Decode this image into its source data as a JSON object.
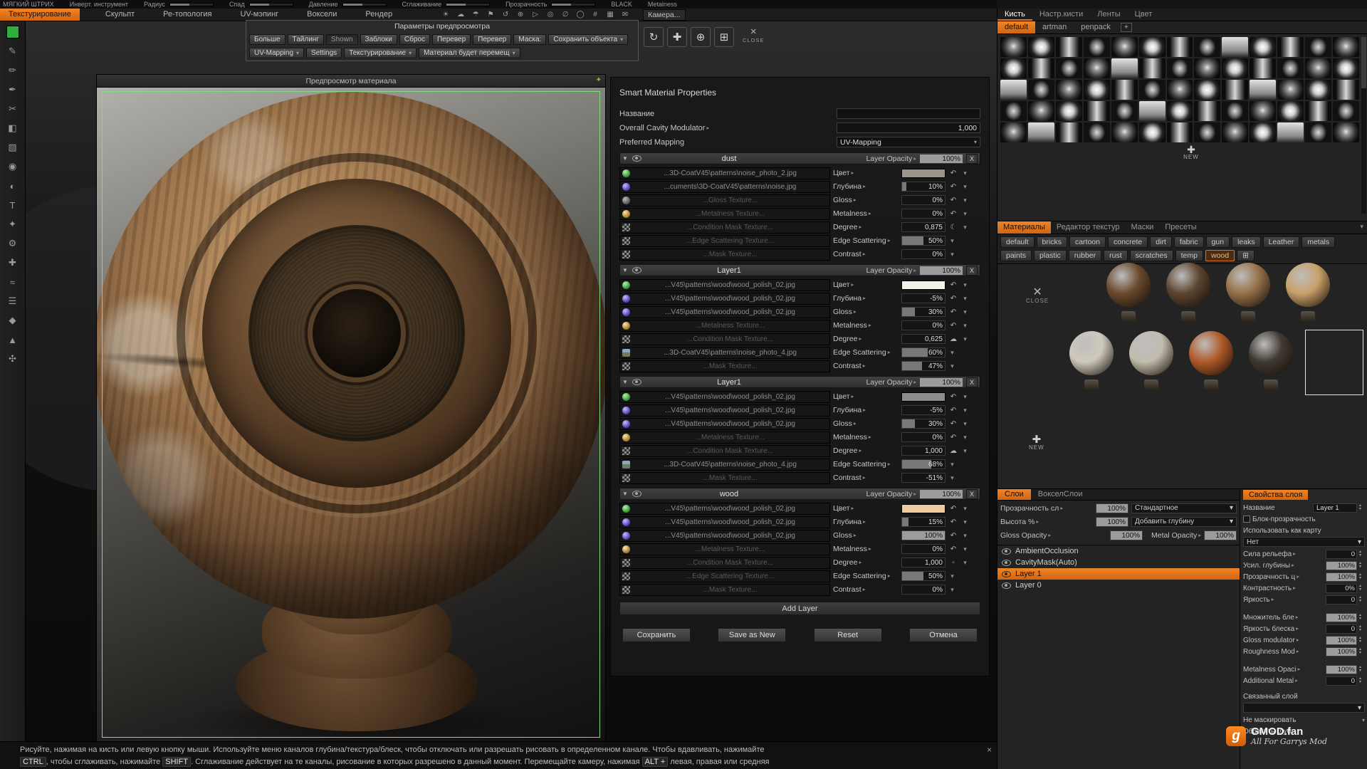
{
  "accent": "#e0711c",
  "topbar": {
    "row1_items": [
      "МЯГКИЙ ШТРИХ",
      "Инверт. инструмент",
      "Радиус",
      "Спад",
      "Давление",
      "Сглаживание",
      "Прозрачность",
      "BLACK",
      "Metalness"
    ],
    "menu_tabs": [
      {
        "label": "Текстурирование",
        "active": true
      },
      {
        "label": "Скульпт"
      },
      {
        "label": "Ре-топология"
      },
      {
        "label": "UV-мэпинг"
      },
      {
        "label": "Воксели"
      },
      {
        "label": "Рендер"
      }
    ],
    "icons": [
      {
        "name": "sun-icon",
        "glyph": "☀"
      },
      {
        "name": "cloud-icon",
        "glyph": "☁"
      },
      {
        "name": "umbrella-icon",
        "glyph": "☂"
      },
      {
        "name": "flag-icon",
        "glyph": "⚑"
      },
      {
        "name": "undo-icon",
        "glyph": "↺"
      },
      {
        "name": "target-icon",
        "glyph": "⊕"
      },
      {
        "name": "play-icon",
        "glyph": "▷"
      },
      {
        "name": "circle-icon",
        "glyph": "◎"
      },
      {
        "name": "null-icon",
        "glyph": "∅"
      },
      {
        "name": "ring-icon",
        "glyph": "◯"
      },
      {
        "name": "grid-icon",
        "glyph": "#"
      },
      {
        "name": "table-icon",
        "glyph": "▦"
      },
      {
        "name": "mail-icon",
        "glyph": "✉"
      }
    ],
    "camera_label": "Камера..."
  },
  "left_tools": [
    {
      "name": "brush-tool",
      "glyph": "✎"
    },
    {
      "name": "pencil-tool",
      "glyph": "✏"
    },
    {
      "name": "pen-tool",
      "glyph": "✒"
    },
    {
      "name": "cut-tool",
      "glyph": "✂"
    },
    {
      "name": "shape-tool",
      "glyph": "◧"
    },
    {
      "name": "hatch-tool",
      "glyph": "▨"
    },
    {
      "name": "dot-tool",
      "glyph": "◉"
    },
    {
      "name": "shade-tool",
      "glyph": "◐"
    },
    {
      "name": "text-tool",
      "glyph": "T"
    },
    {
      "name": "star-tool",
      "glyph": "✦"
    },
    {
      "name": "settings-tool",
      "glyph": "⚙"
    },
    {
      "name": "add-tool",
      "glyph": "✚"
    },
    {
      "name": "wave-tool",
      "glyph": "≈"
    },
    {
      "name": "list-tool",
      "glyph": "☰"
    },
    {
      "name": "diamond-tool",
      "glyph": "◆"
    },
    {
      "name": "prim-tool",
      "glyph": "▲"
    },
    {
      "name": "flower-tool",
      "glyph": "✣"
    }
  ],
  "viewport": {
    "preview_title": "Предпросмотр материала"
  },
  "preview_params": {
    "title": "Параметры предпросмотра",
    "buttons": [
      {
        "label": "Больше"
      },
      {
        "label": "Тайлинг"
      },
      {
        "label": "Shown",
        "pressed": true
      },
      {
        "label": "Заблоки"
      },
      {
        "label": "Сброс"
      },
      {
        "label": "Перевер"
      },
      {
        "label": "Перевер"
      },
      {
        "label": "Маска:"
      },
      {
        "label": "Сохранить объекта",
        "dropdown": true
      }
    ],
    "row2": [
      {
        "label": "UV-Mapping",
        "dropdown": true
      },
      {
        "label": "Settings"
      },
      {
        "label": "Текстурирование",
        "dropdown": true
      },
      {
        "label": "Материал будет перемещ",
        "dropdown": true
      }
    ],
    "transform_icons": [
      {
        "name": "rotate-icon",
        "glyph": "↻"
      },
      {
        "name": "move-icon",
        "glyph": "✚"
      },
      {
        "name": "zoom-icon",
        "glyph": "⊕"
      },
      {
        "name": "pan-icon",
        "glyph": "⊞"
      }
    ],
    "close_label": "CLOSE"
  },
  "smart_material": {
    "title": "Smart Material Properties",
    "name_label": "Название",
    "cavity_label": "Overall Cavity Modulator",
    "cavity_value": "1,000",
    "mapping_label": "Preferred Mapping",
    "mapping_value": "UV-Mapping",
    "opacity_label": "Layer Opacity",
    "add_layer_label": "Add Layer",
    "buttons": [
      "Сохранить",
      "Save as New",
      "Reset",
      "Отмена"
    ],
    "layers": [
      {
        "name": "dust",
        "opacity": "100%",
        "rows": [
          {
            "icon": "sph-green",
            "texture": "...3D-CoatV45\\patterns\\noise_photo_2.jpg",
            "prop": "Цвет",
            "swatch": "#9b948a",
            "undo": true
          },
          {
            "icon": "sph-purple",
            "texture": "...cuments\\3D-CoatV45\\patterns\\noise.jpg",
            "prop": "Глубина",
            "value": "10%",
            "undo": true
          },
          {
            "icon": "sph-dim",
            "texture": "...Gloss Texture...",
            "dim": true,
            "prop": "Gloss",
            "value": "0%",
            "undo": true
          },
          {
            "icon": "sph-gold",
            "texture": "...Metalness Texture...",
            "dim": true,
            "prop": "Metalness",
            "value": "0%",
            "undo": true
          },
          {
            "icon": "checker",
            "texture": "...Condition Mask Texture...",
            "dim": true,
            "prop": "Degree",
            "value": "0,875",
            "extra": "moon"
          },
          {
            "icon": "checker",
            "texture": "...Edge Scattering Texture...",
            "dim": true,
            "prop": "Edge Scattering",
            "value": "50%"
          },
          {
            "icon": "checker",
            "texture": "...Mask Texture...",
            "dim": true,
            "prop": "Contrast",
            "value": "0%"
          }
        ]
      },
      {
        "name": "Layer1",
        "opacity": "100%",
        "rows": [
          {
            "icon": "sph-green",
            "texture": "...V45\\patterns\\wood\\wood_polish_02.jpg",
            "prop": "Цвет",
            "swatch": "#f4f1ea",
            "undo": true
          },
          {
            "icon": "sph-purple",
            "texture": "...V45\\patterns\\wood\\wood_polish_02.jpg",
            "prop": "Глубина",
            "value": "-5%",
            "undo": true
          },
          {
            "icon": "sph-purple",
            "texture": "...V45\\patterns\\wood\\wood_polish_02.jpg",
            "prop": "Gloss",
            "value": "30%",
            "undo": true
          },
          {
            "icon": "sph-gold",
            "texture": "...Metalness Texture...",
            "dim": true,
            "prop": "Metalness",
            "value": "0%",
            "undo": true
          },
          {
            "icon": "checker",
            "texture": "...Condition Mask Texture...",
            "dim": true,
            "prop": "Degree",
            "value": "0,625",
            "extra": "cloud"
          },
          {
            "icon": "photo",
            "texture": "...3D-CoatV45\\patterns\\noise_photo_4.jpg",
            "prop": "Edge Scattering",
            "value": "60%"
          },
          {
            "icon": "checker",
            "texture": "...Mask Texture...",
            "dim": true,
            "prop": "Contrast",
            "value": "47%"
          }
        ]
      },
      {
        "name": "Layer1",
        "opacity": "100%",
        "rows": [
          {
            "icon": "sph-green",
            "texture": "...V45\\patterns\\wood\\wood_polish_02.jpg",
            "prop": "Цвет",
            "swatch": "#8e8d8a",
            "undo": true
          },
          {
            "icon": "sph-purple",
            "texture": "...V45\\patterns\\wood\\wood_polish_02.jpg",
            "prop": "Глубина",
            "value": "-5%",
            "undo": true
          },
          {
            "icon": "sph-purple",
            "texture": "...V45\\patterns\\wood\\wood_polish_02.jpg",
            "prop": "Gloss",
            "value": "30%",
            "undo": true
          },
          {
            "icon": "sph-gold",
            "texture": "...Metalness Texture...",
            "dim": true,
            "prop": "Metalness",
            "value": "0%",
            "undo": true
          },
          {
            "icon": "checker",
            "texture": "...Condition Mask Texture...",
            "dim": true,
            "prop": "Degree",
            "value": "1,000",
            "extra": "cloud"
          },
          {
            "icon": "photo",
            "texture": "...3D-CoatV45\\patterns\\noise_photo_4.jpg",
            "prop": "Edge Scattering",
            "value": "68%"
          },
          {
            "icon": "checker",
            "texture": "...Mask Texture...",
            "dim": true,
            "prop": "Contrast",
            "value": "-51%"
          }
        ]
      },
      {
        "name": "wood",
        "opacity": "100%",
        "rows": [
          {
            "icon": "sph-green",
            "texture": "...V45\\patterns\\wood\\wood_polish_02.jpg",
            "prop": "Цвет",
            "swatch": "#eecb9f",
            "undo": true
          },
          {
            "icon": "sph-purple",
            "texture": "...V45\\patterns\\wood\\wood_polish_02.jpg",
            "prop": "Глубина",
            "value": "15%",
            "undo": true
          },
          {
            "icon": "sph-purple",
            "texture": "...V45\\patterns\\wood\\wood_polish_02.jpg",
            "prop": "Gloss",
            "value": "100%",
            "undo": true
          },
          {
            "icon": "sph-gold",
            "texture": "...Metalness Texture...",
            "dim": true,
            "prop": "Metalness",
            "value": "0%",
            "undo": true
          },
          {
            "icon": "checker",
            "texture": "...Condition Mask Texture...",
            "dim": true,
            "prop": "Degree",
            "value": "1,000",
            "extra": "square"
          },
          {
            "icon": "checker",
            "texture": "...Edge Scattering Texture...",
            "dim": true,
            "prop": "Edge Scattering",
            "value": "50%"
          },
          {
            "icon": "checker",
            "texture": "...Mask Texture...",
            "dim": true,
            "prop": "Contrast",
            "value": "0%"
          }
        ]
      }
    ]
  },
  "brush_panel": {
    "tabs": [
      {
        "label": "Кисть",
        "active": true
      },
      {
        "label": "Настр.кисти"
      },
      {
        "label": "Ленты"
      },
      {
        "label": "Цвет"
      }
    ],
    "preset_tabs": [
      {
        "label": "default",
        "active": true
      },
      {
        "label": "artman"
      },
      {
        "label": "penpack"
      }
    ],
    "grid": {
      "rows": 5,
      "cols": 13
    },
    "new_label": "NEW"
  },
  "materials_panel": {
    "tabs": [
      {
        "label": "Материалы",
        "active": true
      },
      {
        "label": "Редактор текстур"
      },
      {
        "label": "Маски"
      },
      {
        "label": "Пресеты"
      }
    ],
    "categories": [
      "default",
      "bricks",
      "cartoon",
      "concrete",
      "dirt",
      "fabric",
      "gun",
      "leaks",
      "Leather",
      "metals",
      "paints",
      "plastic",
      "rubber",
      "rust",
      "scratches",
      "temp",
      "wood"
    ],
    "active_category": "wood",
    "close_label": "CLOSE",
    "new_label": "NEW",
    "thumbs": [
      {
        "color": "#6b4a2e"
      },
      {
        "color": "#5d4530"
      },
      {
        "color": "#96714a"
      },
      {
        "color": "#c9a06a"
      },
      {
        "color": "#cfc9bd"
      },
      {
        "color": "#c2bcae"
      },
      {
        "color": "#b05a28"
      },
      {
        "color": "#403a32"
      }
    ]
  },
  "layers_panel": {
    "tabs": [
      {
        "label": "Слои",
        "active": true
      },
      {
        "label": "ВокселСлои"
      }
    ],
    "controls": {
      "row1_label": "Прозрачность сл",
      "row1_value": "100%",
      "row1_dropdown": "Стандартное",
      "row2_label": "Высота %",
      "row2_value": "100%",
      "row2_dropdown": "Добавить глубину",
      "row3a_label": "Gloss Opacity",
      "row3a_value": "100%",
      "row3b_label": "Metal Opacity",
      "row3b_value": "100%"
    },
    "items": [
      {
        "name": "AmbientOcclusion"
      },
      {
        "name": "CavityMask(Auto)"
      },
      {
        "name": "Layer 1",
        "selected": true
      },
      {
        "name": "Layer 0"
      }
    ]
  },
  "layer_props": {
    "tab": "Свойства слоя",
    "name_label": "Название",
    "name_value": "Layer 1",
    "lock_label": "Блок-прозрачность",
    "use_as_label": "Использовать как карту",
    "use_as_value": "Нет",
    "rows": [
      {
        "label": "Сила рельефа",
        "value": "0"
      },
      {
        "label": "Усил. глубины",
        "value": "100%"
      },
      {
        "label": "Прозрачность ц",
        "value": "100%"
      },
      {
        "label": "Контрастность",
        "value": "0%"
      },
      {
        "label": "Яркость",
        "value": "0",
        "gap": true
      },
      {
        "label": "Множитель бле",
        "value": "100%"
      },
      {
        "label": "Яркость блеска",
        "value": "0"
      },
      {
        "label": "Gloss modulator",
        "value": "100%"
      },
      {
        "label": "Roughness Mod",
        "value": "100%",
        "gap": true
      },
      {
        "label": "Metalness Opaci",
        "value": "100%"
      },
      {
        "label": "Additional Metal",
        "value": "0"
      }
    ],
    "linked_label": "Связанный слой",
    "mask_label": "Не маскировать",
    "invert_label": "Обратить глуб"
  },
  "statusbar": {
    "line1": "Рисуйте, нажимая на кисть или левую кнопку мыши. Используйте меню каналов глубина/текстура/блеск, чтобы отключать или разрешать рисовать в определенном канале. Чтобы вдавливать, нажимайте",
    "line2_segments": [
      {
        "text": "CTRL",
        "key": true
      },
      {
        "text": ", чтобы сглаживать, нажимайте "
      },
      {
        "text": "SHIFT",
        "key": true
      },
      {
        "text": ". Сглаживание действует на те каналы, рисование в которых разрешено в данный момент. Перемещайте камеру, нажимая "
      },
      {
        "text": "ALT +",
        "key": true
      },
      {
        "text": " левая, правая или средняя"
      }
    ]
  },
  "watermark": {
    "badge": "g",
    "title": "GMOD.fan",
    "subtitle": "All For Garrys Mod"
  }
}
